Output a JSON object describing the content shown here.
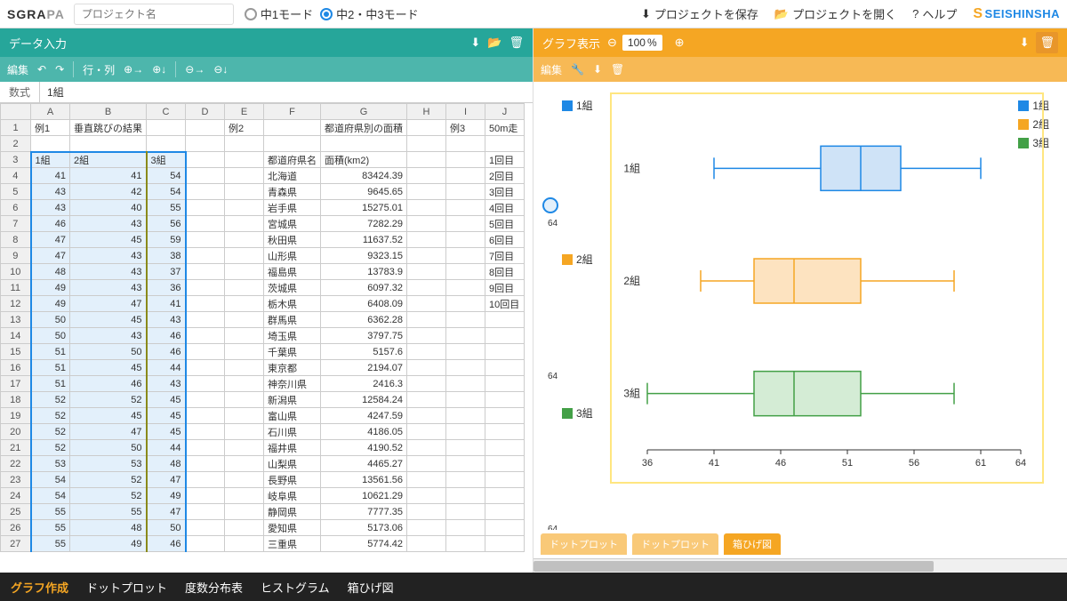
{
  "topbar": {
    "logo_a": "SGRA",
    "logo_b": "PA",
    "project_placeholder": "プロジェクト名",
    "mode1": "中1モード",
    "mode2": "中2・中3モード",
    "save": "プロジェクトを保存",
    "open": "プロジェクトを開く",
    "help": "ヘルプ",
    "brand": "SEISHINSHA"
  },
  "left": {
    "title": "データ入力",
    "toolbar": {
      "edit": "編集",
      "rowcol": "行・列"
    },
    "formula": {
      "label": "数式",
      "value": "1組"
    },
    "columns": [
      "A",
      "B",
      "C",
      "D",
      "E",
      "F",
      "G",
      "H",
      "I",
      "J"
    ],
    "rows": [
      {
        "n": 1,
        "cells": [
          "例1",
          "垂直跳びの結果",
          "",
          "",
          "例2",
          "",
          "都道府県別の面積",
          "",
          "例3",
          "50m走"
        ]
      },
      {
        "n": 2,
        "cells": [
          "",
          "",
          "",
          "",
          "",
          "",
          "",
          "",
          "",
          ""
        ]
      },
      {
        "n": 3,
        "cells": [
          "1組",
          "2組",
          "3組",
          "",
          "",
          "都道府県名",
          "面積(km2)",
          "",
          "",
          "1回目"
        ]
      },
      {
        "n": 4,
        "cells": [
          "41",
          "41",
          "54",
          "",
          "",
          "北海道",
          "83424.39",
          "",
          "",
          "2回目"
        ]
      },
      {
        "n": 5,
        "cells": [
          "43",
          "42",
          "54",
          "",
          "",
          "青森県",
          "9645.65",
          "",
          "",
          "3回目"
        ]
      },
      {
        "n": 6,
        "cells": [
          "43",
          "40",
          "55",
          "",
          "",
          "岩手県",
          "15275.01",
          "",
          "",
          "4回目"
        ]
      },
      {
        "n": 7,
        "cells": [
          "46",
          "43",
          "56",
          "",
          "",
          "宮城県",
          "7282.29",
          "",
          "",
          "5回目"
        ]
      },
      {
        "n": 8,
        "cells": [
          "47",
          "45",
          "59",
          "",
          "",
          "秋田県",
          "11637.52",
          "",
          "",
          "6回目"
        ]
      },
      {
        "n": 9,
        "cells": [
          "47",
          "43",
          "38",
          "",
          "",
          "山形県",
          "9323.15",
          "",
          "",
          "7回目"
        ]
      },
      {
        "n": 10,
        "cells": [
          "48",
          "43",
          "37",
          "",
          "",
          "福島県",
          "13783.9",
          "",
          "",
          "8回目"
        ]
      },
      {
        "n": 11,
        "cells": [
          "49",
          "43",
          "36",
          "",
          "",
          "茨城県",
          "6097.32",
          "",
          "",
          "9回目"
        ]
      },
      {
        "n": 12,
        "cells": [
          "49",
          "47",
          "41",
          "",
          "",
          "栃木県",
          "6408.09",
          "",
          "",
          "10回目"
        ]
      },
      {
        "n": 13,
        "cells": [
          "50",
          "45",
          "43",
          "",
          "",
          "群馬県",
          "6362.28",
          "",
          "",
          ""
        ]
      },
      {
        "n": 14,
        "cells": [
          "50",
          "43",
          "46",
          "",
          "",
          "埼玉県",
          "3797.75",
          "",
          "",
          ""
        ]
      },
      {
        "n": 15,
        "cells": [
          "51",
          "50",
          "46",
          "",
          "",
          "千葉県",
          "5157.6",
          "",
          "",
          ""
        ]
      },
      {
        "n": 16,
        "cells": [
          "51",
          "45",
          "44",
          "",
          "",
          "東京都",
          "2194.07",
          "",
          "",
          ""
        ]
      },
      {
        "n": 17,
        "cells": [
          "51",
          "46",
          "43",
          "",
          "",
          "神奈川県",
          "2416.3",
          "",
          "",
          ""
        ]
      },
      {
        "n": 18,
        "cells": [
          "52",
          "52",
          "45",
          "",
          "",
          "新潟県",
          "12584.24",
          "",
          "",
          ""
        ]
      },
      {
        "n": 19,
        "cells": [
          "52",
          "45",
          "45",
          "",
          "",
          "富山県",
          "4247.59",
          "",
          "",
          ""
        ]
      },
      {
        "n": 20,
        "cells": [
          "52",
          "47",
          "45",
          "",
          "",
          "石川県",
          "4186.05",
          "",
          "",
          ""
        ]
      },
      {
        "n": 21,
        "cells": [
          "52",
          "50",
          "44",
          "",
          "",
          "福井県",
          "4190.52",
          "",
          "",
          ""
        ]
      },
      {
        "n": 22,
        "cells": [
          "53",
          "53",
          "48",
          "",
          "",
          "山梨県",
          "4465.27",
          "",
          "",
          ""
        ]
      },
      {
        "n": 23,
        "cells": [
          "54",
          "52",
          "47",
          "",
          "",
          "長野県",
          "13561.56",
          "",
          "",
          ""
        ]
      },
      {
        "n": 24,
        "cells": [
          "54",
          "52",
          "49",
          "",
          "",
          "岐阜県",
          "10621.29",
          "",
          "",
          ""
        ]
      },
      {
        "n": 25,
        "cells": [
          "55",
          "55",
          "47",
          "",
          "",
          "静岡県",
          "7777.35",
          "",
          "",
          ""
        ]
      },
      {
        "n": 26,
        "cells": [
          "55",
          "48",
          "50",
          "",
          "",
          "愛知県",
          "5173.06",
          "",
          "",
          ""
        ]
      },
      {
        "n": 27,
        "cells": [
          "55",
          "49",
          "46",
          "",
          "",
          "三重県",
          "5774.42",
          "",
          "",
          ""
        ]
      }
    ]
  },
  "right": {
    "title": "グラフ表示",
    "zoom": "100",
    "zoom_unit": "%",
    "toolbar": {
      "edit": "編集"
    },
    "legend": [
      "1組",
      "2組",
      "3組"
    ],
    "axis_labels": [
      "1組",
      "2組",
      "3組"
    ],
    "ytick": "64",
    "chart_tabs": [
      "ドットプロット",
      "ドットプロット",
      "箱ひげ図"
    ]
  },
  "chart_data": {
    "type": "boxplot",
    "title": "",
    "xlabel": "",
    "ylabel": "",
    "xlim": [
      36,
      64
    ],
    "xticks": [
      36,
      41,
      46,
      51,
      56,
      61,
      64
    ],
    "series": [
      {
        "name": "1組",
        "color": "#1e88e5",
        "min": 41,
        "q1": 49,
        "median": 52,
        "q3": 55,
        "max": 61
      },
      {
        "name": "2組",
        "color": "#f5a623",
        "min": 40,
        "q1": 44,
        "median": 47,
        "q3": 52,
        "max": 59
      },
      {
        "name": "3組",
        "color": "#43a047",
        "min": 36,
        "q1": 44,
        "median": 47,
        "q3": 52,
        "max": 59
      }
    ]
  },
  "bottom": {
    "create": "グラフ作成",
    "items": [
      "ドットプロット",
      "度数分布表",
      "ヒストグラム",
      "箱ひげ図"
    ]
  }
}
